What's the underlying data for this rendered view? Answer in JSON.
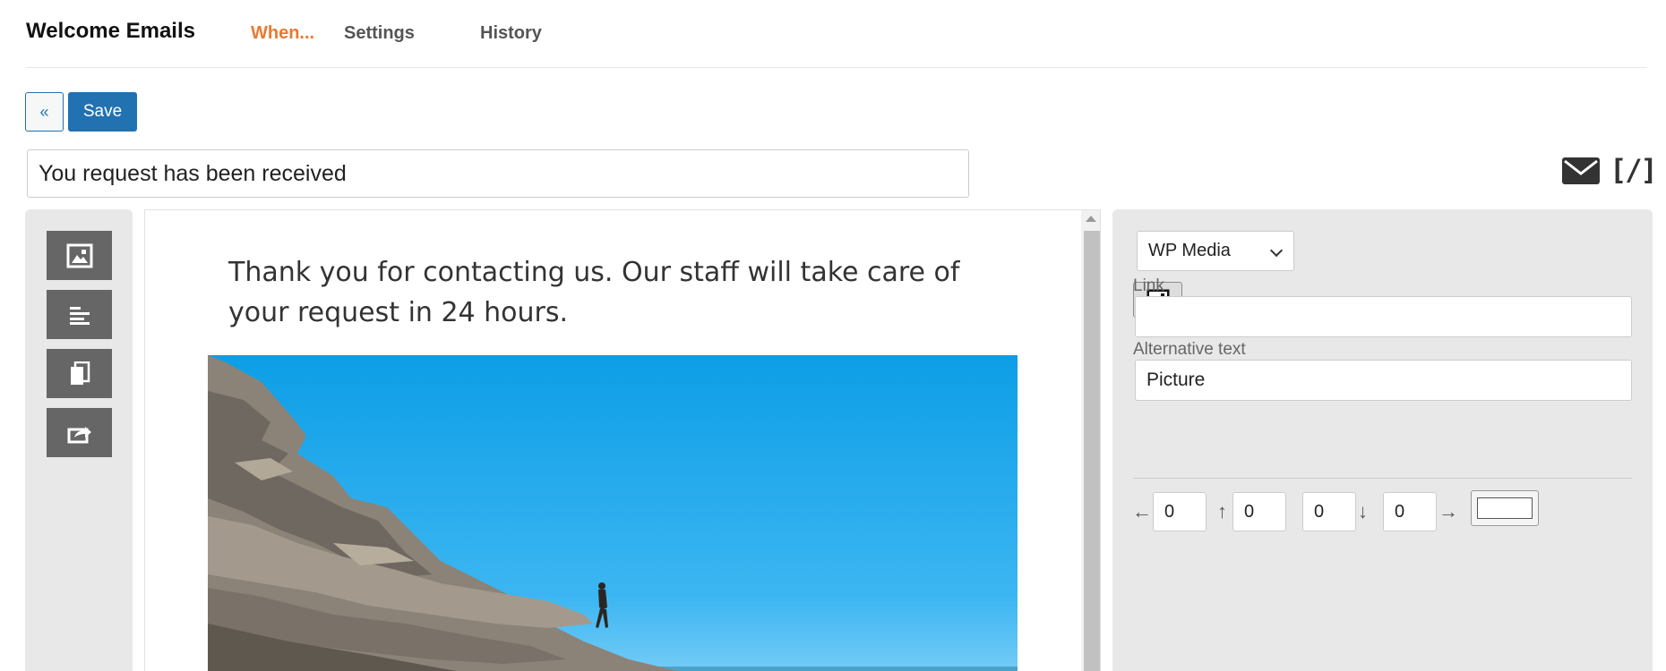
{
  "header": {
    "title": "Welcome Emails",
    "tabs": [
      {
        "label": "When...",
        "active": true
      },
      {
        "label": "Settings",
        "active": false
      },
      {
        "label": "History",
        "active": false
      }
    ]
  },
  "toolbar": {
    "back_label": "«",
    "save_label": "Save"
  },
  "subject": {
    "value": "You request has been received"
  },
  "top_right_icons": {
    "mail_icon": "mail-icon",
    "shortcode_label": "[/]"
  },
  "blocks_palette": {
    "items": [
      {
        "icon": "image-block-icon"
      },
      {
        "icon": "text-block-icon"
      },
      {
        "icon": "copy-block-icon"
      },
      {
        "icon": "share-block-icon"
      }
    ]
  },
  "canvas": {
    "paragraph": "Thank you for contacting us. Our staff will take care of your request in 24 hours.",
    "image_alt": "Picture"
  },
  "image_settings": {
    "source_select": "WP Media",
    "media_button_icon": "image-icon",
    "link_label": "Link",
    "link_value": "",
    "alt_label": "Alternative text",
    "alt_value": "Picture",
    "padding": {
      "left_arrow": "←",
      "left": "0",
      "top_arrow": "↑",
      "top": "0",
      "bottom": "0",
      "bottom_arrow": "↓",
      "right": "0",
      "right_arrow": "→"
    },
    "background_color": "#ffffff"
  },
  "colors": {
    "accent": "#2271b1",
    "active_tab": "#e8792f",
    "sky": "#0fa3e6"
  }
}
